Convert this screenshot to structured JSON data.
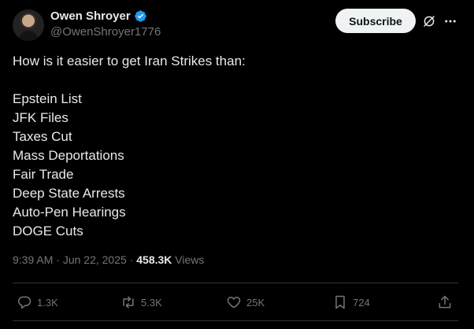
{
  "author": {
    "display_name": "Owen Shroyer",
    "handle": "@OwenShroyer1776"
  },
  "header": {
    "subscribe_label": "Subscribe"
  },
  "tweet": {
    "lines": [
      "How is it easier to get Iran Strikes than:",
      "",
      "Epstein List",
      "JFK Files",
      "Taxes Cut",
      "Mass Deportations",
      "Fair Trade",
      "Deep State Arrests",
      "Auto-Pen Hearings",
      "DOGE Cuts"
    ]
  },
  "meta": {
    "time": "9:39 AM",
    "date": "Jun 22, 2025",
    "separator": "·",
    "views_count": "458.3K",
    "views_label": "Views"
  },
  "actions": {
    "replies": "1.3K",
    "reposts": "5.3K",
    "likes": "25K",
    "bookmarks": "724"
  },
  "colors": {
    "background": "#000000",
    "text": "#e7e9ea",
    "secondary": "#71767b",
    "verified_badge": "#1d9bf0",
    "divider": "#2f3336"
  }
}
